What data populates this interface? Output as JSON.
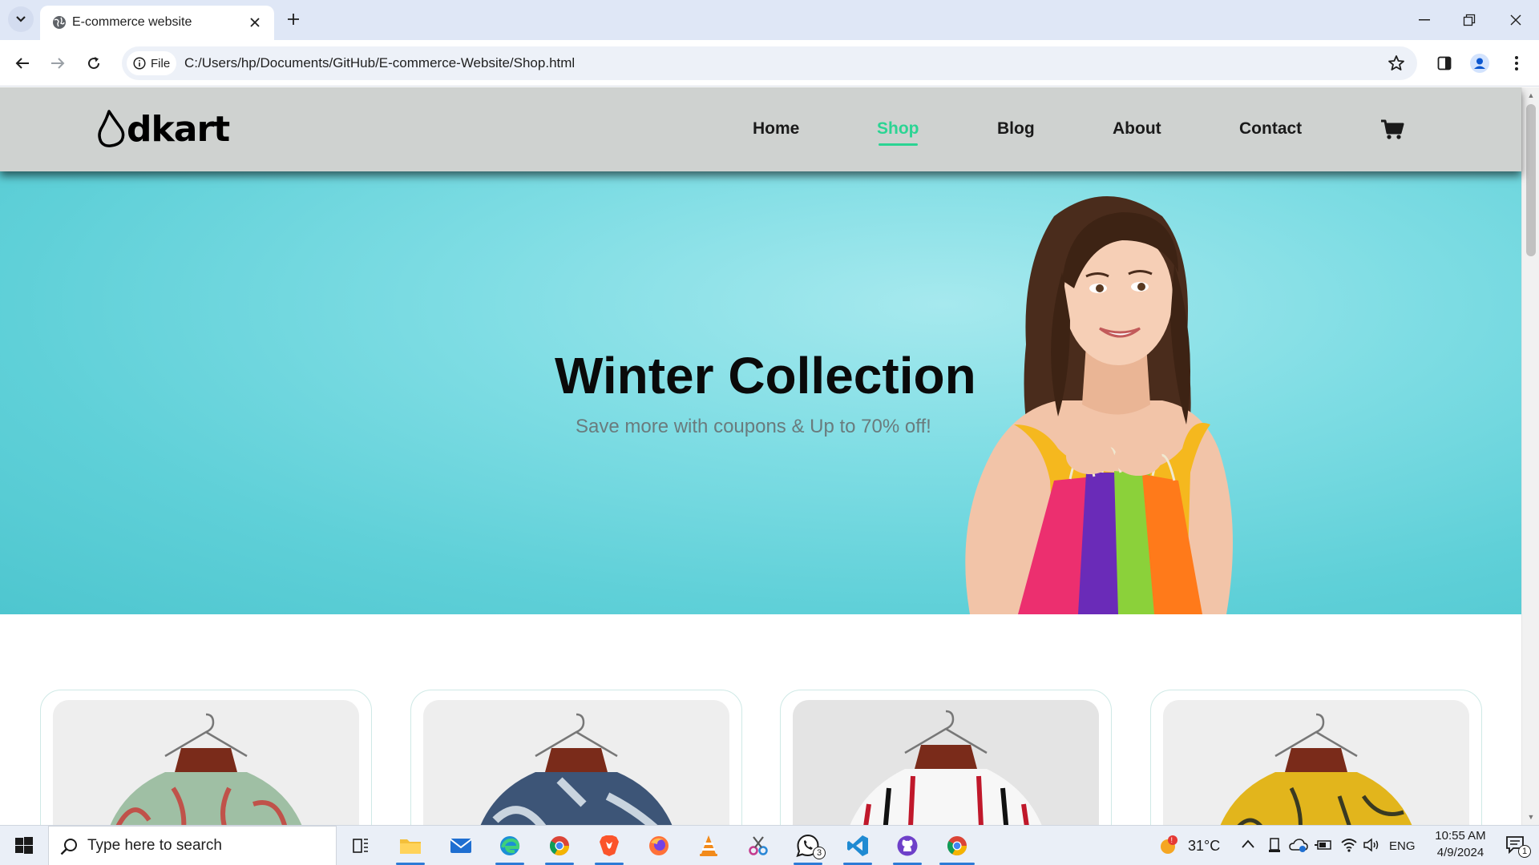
{
  "browser": {
    "tab_title": "E-commerce website",
    "address_chip": "File",
    "url": "C:/Users/hp/Documents/GitHub/E-commerce-Website/Shop.html"
  },
  "site": {
    "logo_text": "dkart",
    "nav": [
      {
        "label": "Home",
        "active": false
      },
      {
        "label": "Shop",
        "active": true
      },
      {
        "label": "Blog",
        "active": false
      },
      {
        "label": "About",
        "active": false
      },
      {
        "label": "Contact",
        "active": false
      }
    ],
    "accent_color": "#2bd493",
    "hero": {
      "title": "Winter Collection",
      "subtitle": "Save more with coupons & Up to 70% off!"
    },
    "products": [
      {
        "image": "floral-green-shirt"
      },
      {
        "image": "blue-print-shirt"
      },
      {
        "image": "striped-red-black-shirt"
      },
      {
        "image": "yellow-leaf-shirt"
      }
    ]
  },
  "taskbar": {
    "search_placeholder": "Type here to search",
    "weather": "31°C",
    "language": "ENG",
    "time": "10:55 AM",
    "date": "4/9/2024",
    "whatsapp_badge": "3",
    "notification_count": "1"
  }
}
